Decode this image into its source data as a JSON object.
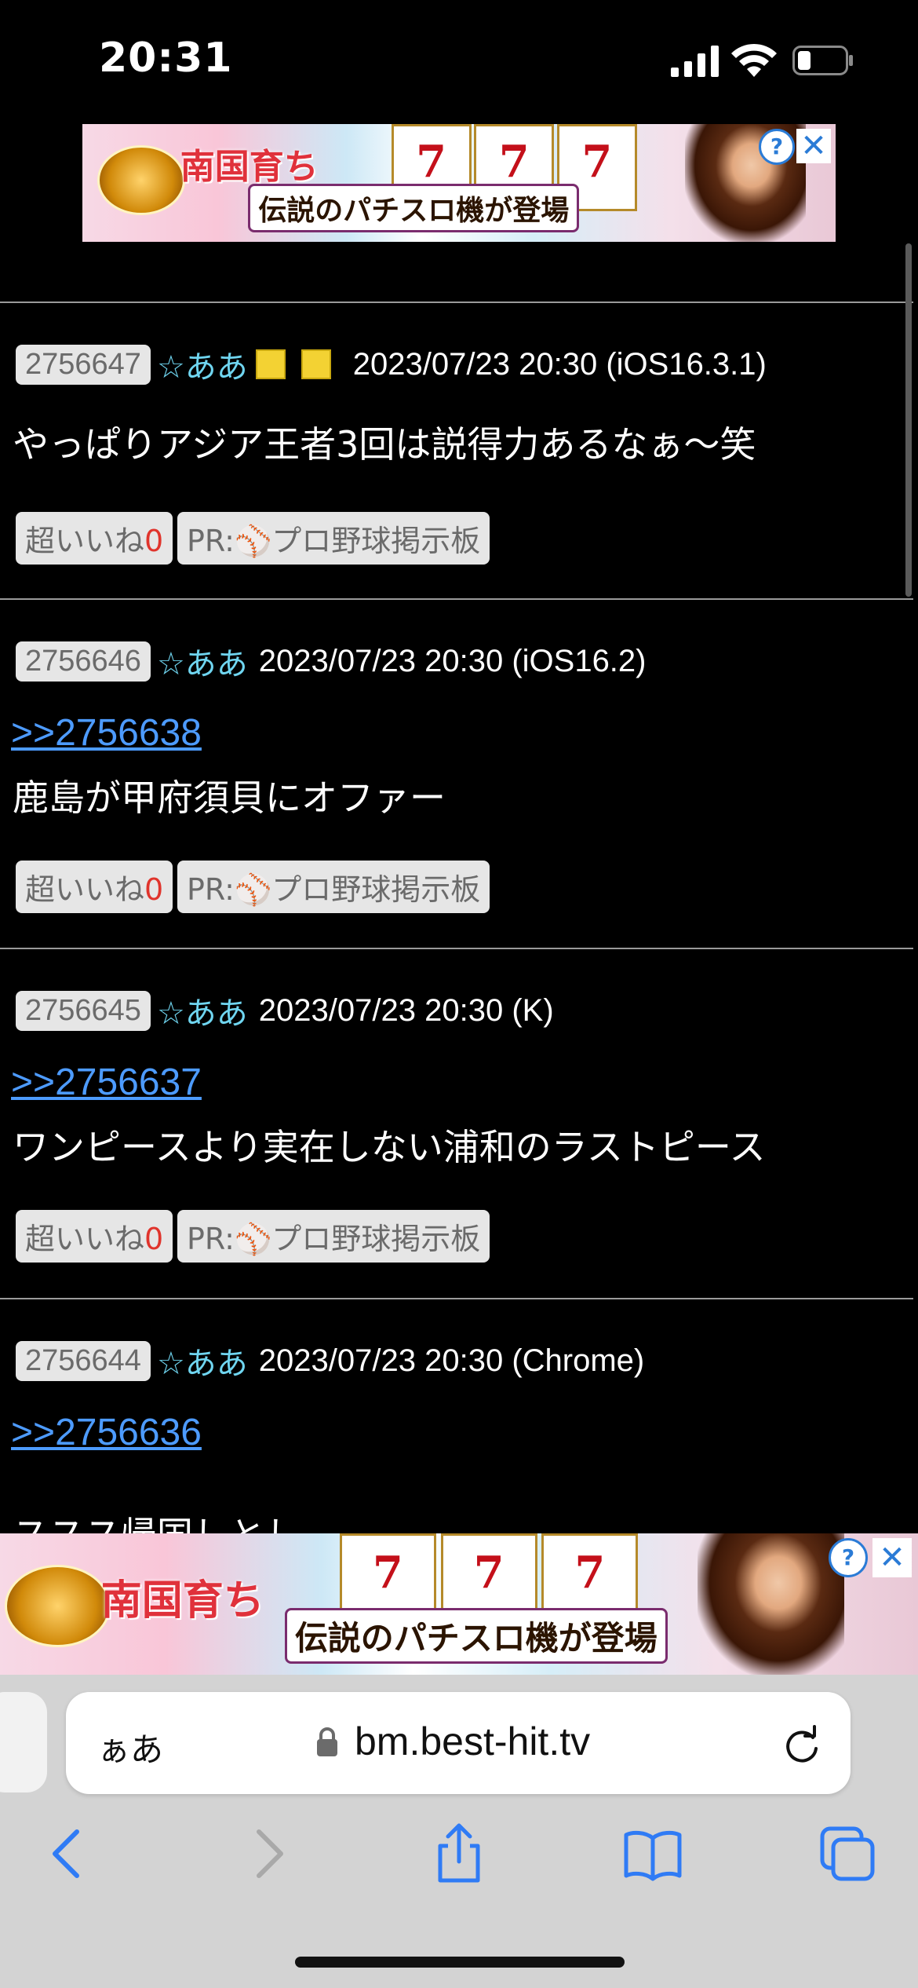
{
  "status_bar": {
    "time": "20:31"
  },
  "ads": {
    "top": {
      "title": "南国育ち",
      "caption": "伝説のパチスロ機が登場",
      "reel": "7"
    },
    "bottom": {
      "title": "南国育ち",
      "caption": "伝説のパチスロ機が登場",
      "reel": "7"
    },
    "help_glyph": "?",
    "close_glyph": "✕"
  },
  "posts": [
    {
      "id": "2756647",
      "name": "☆ああ",
      "datetime": "2023/07/23 20:30 (iOS16.3.1)",
      "anchor": "",
      "body": "やっぱりアジア王者3回は説得力あるなぁ～笑",
      "like_label": "超いいね",
      "like_count": "0",
      "pr_label": "PR:⚾プロ野球掲示板",
      "badge_color": "#F3D233"
    },
    {
      "id": "2756646",
      "name": "☆ああ",
      "datetime": "2023/07/23 20:30 (iOS16.2)",
      "anchor": ">>2756638",
      "body": "鹿島が甲府須貝にオファー",
      "like_label": "超いいね",
      "like_count": "0",
      "pr_label": "PR:⚾プロ野球掲示板"
    },
    {
      "id": "2756645",
      "name": "☆ああ",
      "datetime": "2023/07/23 20:30 (K)",
      "anchor": ">>2756637",
      "body": "ワンピースより実在しない浦和のラストピース",
      "like_label": "超いいね",
      "like_count": "0",
      "pr_label": "PR:⚾プロ野球掲示板"
    },
    {
      "id": "2756644",
      "name": "☆ああ",
      "datetime": "2023/07/23 20:30 (Chrome)",
      "anchor": ">>2756636",
      "body": "ススス帰国しとし"
    }
  ],
  "browser": {
    "aa_label": "ぁあ",
    "url": "bm.best-hit.tv",
    "toolbar": [
      "back-icon",
      "forward-icon",
      "share-icon",
      "bookmarks-icon",
      "tabs-icon"
    ],
    "accent_color": "#2F7BF5"
  }
}
